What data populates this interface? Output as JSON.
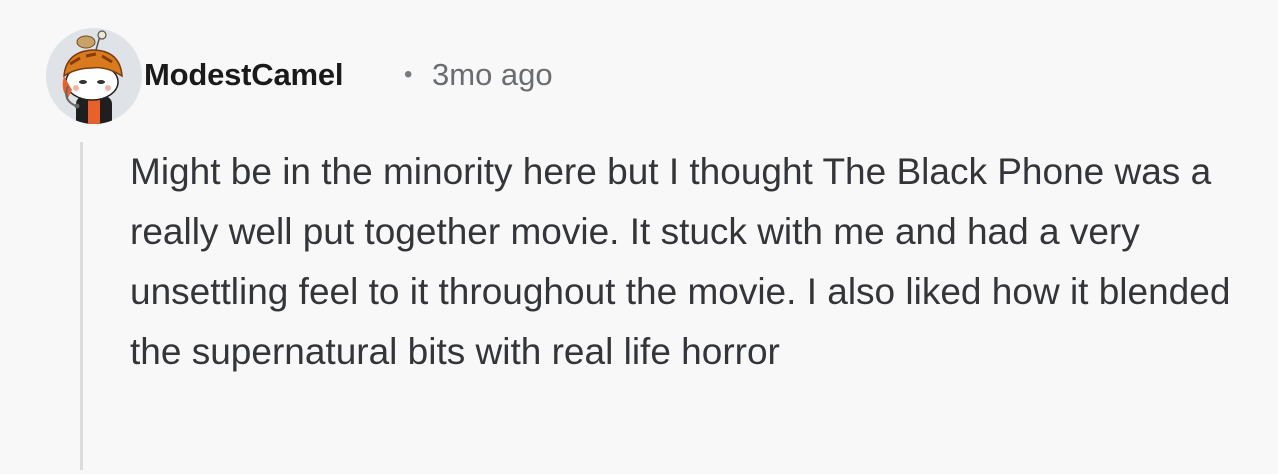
{
  "comment": {
    "username": "ModestCamel",
    "separator": "•",
    "timestamp": "3mo ago",
    "avatar_icon": "snoo-avatar-icon",
    "body": "Might be in the minority here but I thought The Black Phone was a really well put together movie. It stuck with me and had a very unsettling feel to it throughout the movie. I also liked how it blended the supernatural bits with real life horror"
  },
  "colors": {
    "background": "#f8f8f8",
    "username": "#1a1a1b",
    "meta": "#6a6d70",
    "body_text": "#333538",
    "thread_line": "#dcdcdc",
    "avatar_bg": "#dfe3e8",
    "avatar_hat": "#d97a1e"
  }
}
